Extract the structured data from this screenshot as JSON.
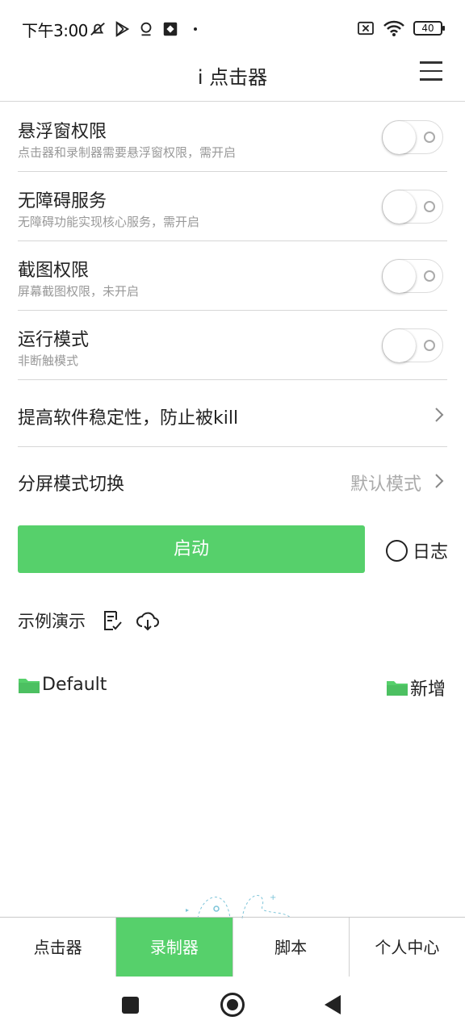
{
  "status_bar": {
    "time": "下午3:00",
    "battery": "40",
    "left_icons": [
      "mute-bell-icon",
      "play-store-icon",
      "location-icon",
      "app-icon"
    ],
    "right_icons": [
      "sim-off-icon",
      "wifi-icon",
      "battery-icon"
    ]
  },
  "header": {
    "title": "i 点击器",
    "menu_icon": "hamburger-menu-icon"
  },
  "settings": [
    {
      "title": "悬浮窗权限",
      "subtitle": "点击器和录制器需要悬浮窗权限，需开启",
      "enabled": false
    },
    {
      "title": "无障碍服务",
      "subtitle": "无障碍功能实现核心服务，需开启",
      "enabled": false
    },
    {
      "title": "截图权限",
      "subtitle": "屏幕截图权限，未开启",
      "enabled": false
    },
    {
      "title": "运行模式",
      "subtitle": "非断触模式",
      "enabled": false
    }
  ],
  "nav_rows": [
    {
      "label": "提高软件稳定性，防止被kill",
      "value": ""
    },
    {
      "label": "分屏模式切换",
      "value": "默认模式"
    }
  ],
  "actions": {
    "start_label": "启动",
    "log_label": "日志"
  },
  "demo": {
    "label": "示例演示",
    "icons": [
      "checklist-icon",
      "cloud-download-icon"
    ]
  },
  "folders": {
    "default_label": "Default",
    "add_label": "新增"
  },
  "tabs": [
    {
      "label": "点击器",
      "active": false
    },
    {
      "label": "录制器",
      "active": true
    },
    {
      "label": "脚本",
      "active": false
    },
    {
      "label": "个人中心",
      "active": false
    }
  ],
  "colors": {
    "accent": "#56d06b",
    "divider": "#d6d6d6",
    "subtext": "#999999"
  }
}
